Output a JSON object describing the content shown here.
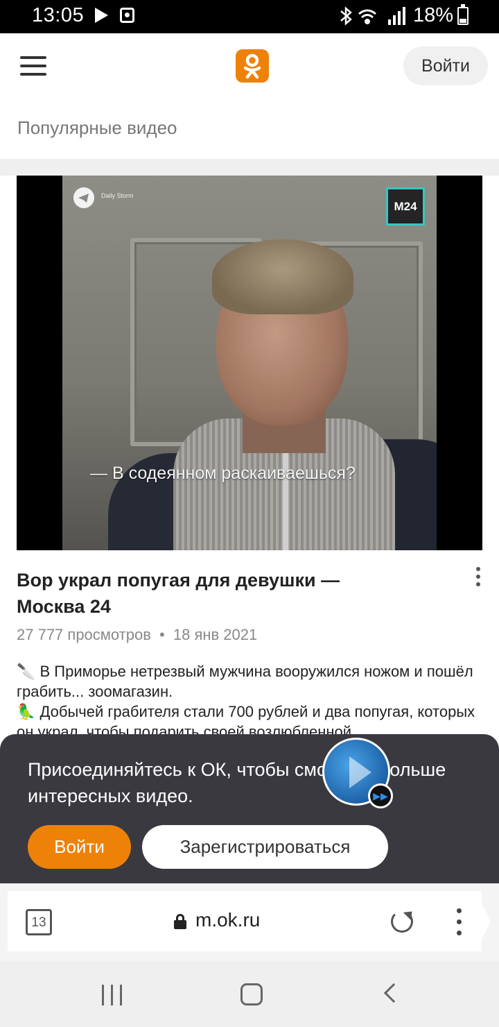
{
  "status_bar": {
    "time": "13:05",
    "battery_percent": "18%",
    "icons": [
      "play-icon",
      "alarm-icon",
      "bluetooth-icon",
      "wifi-icon",
      "signal-icon",
      "battery-icon"
    ]
  },
  "header": {
    "menu_icon": "hamburger-icon",
    "logo_icon": "ok-logo-icon",
    "login_label": "Войти"
  },
  "section": {
    "title": "Популярные видео"
  },
  "video": {
    "overlay_source": "Daily Storm",
    "channel_badge": "M24",
    "caption": "— В содеянном раскаиваешься?",
    "title": "Вор украл попугая для девушки — Москва 24",
    "views": "27 777 просмотров",
    "separator": "•",
    "date": "18 янв 2021",
    "description_line1": "🔪 В Приморье нетрезвый мужчина вооружился ножом и пошёл грабить... зоомагазин.",
    "description_line2": "🦜 Добычей грабителя стали 700 рублей и два попугая, которых он украл, чтобы подарить своей возлюбленной."
  },
  "promo": {
    "text": "Присоединяйтесь к ОК, чтобы смотреть больше интересных видео.",
    "login_label": "Войти",
    "register_label": "Зарегистрироваться",
    "colors": {
      "sheet": "#3b3940",
      "accent": "#ee8208"
    }
  },
  "browser": {
    "tab_count": "13",
    "url": "m.ok.ru"
  },
  "navbar": {
    "icons": [
      "recent-apps-icon",
      "home-icon",
      "back-icon"
    ]
  }
}
